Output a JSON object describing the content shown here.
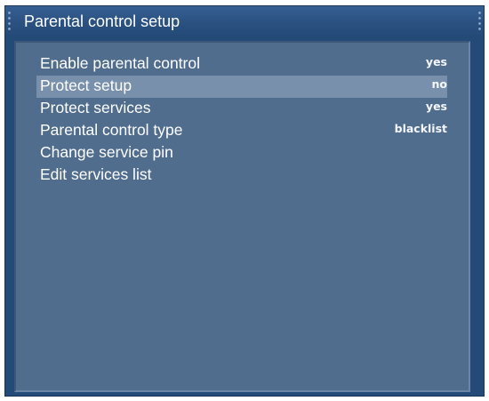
{
  "window": {
    "title": "Parental control setup"
  },
  "menu": {
    "selected_index": 1,
    "items": [
      {
        "label": "Enable parental control",
        "value": "yes"
      },
      {
        "label": "Protect setup",
        "value": "no"
      },
      {
        "label": "Protect services",
        "value": "yes"
      },
      {
        "label": "Parental control type",
        "value": "blacklist"
      },
      {
        "label": "Change service pin",
        "value": ""
      },
      {
        "label": "Edit services list",
        "value": ""
      }
    ]
  },
  "colors": {
    "frame": "#244a78",
    "panel": "#506d8e",
    "highlight": "#7990ad",
    "text": "#ffffff"
  }
}
